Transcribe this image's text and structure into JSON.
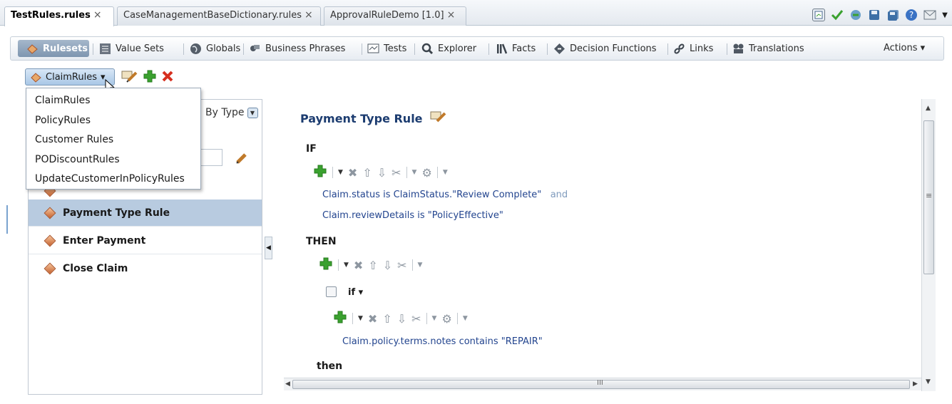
{
  "editor_tabs": [
    {
      "label": "TestRules.rules",
      "close": "×"
    },
    {
      "label": "CaseManagementBaseDictionary.rules",
      "close": "×"
    },
    {
      "label": "ApprovalRuleDemo [1.0]",
      "close": "×"
    }
  ],
  "nav": {
    "items": [
      {
        "label": "Rulesets",
        "icon": "rulesets-icon"
      },
      {
        "label": "Value Sets",
        "icon": "value-sets-icon"
      },
      {
        "label": "Globals",
        "icon": "globe-icon"
      },
      {
        "label": "Business Phrases",
        "icon": "business-phrases-icon"
      },
      {
        "label": "Tests",
        "icon": "tests-icon"
      },
      {
        "label": "Explorer",
        "icon": "search-icon"
      },
      {
        "label": "Facts",
        "icon": "facts-icon"
      },
      {
        "label": "Decision Functions",
        "icon": "decision-functions-icon"
      },
      {
        "label": "Links",
        "icon": "link-icon"
      },
      {
        "label": "Translations",
        "icon": "translations-icon"
      }
    ],
    "actions": "Actions ▾"
  },
  "ruleset_selector": {
    "value": "ClaimRules",
    "arrow": "▾"
  },
  "dropdown_options": [
    "ClaimRules",
    "PolicyRules",
    "Customer Rules",
    "PODiscountRules",
    "UpdateCustomerInPolicyRules"
  ],
  "left_panel": {
    "sort_label": "By Type",
    "rules": [
      "Payment Type Rule",
      "Enter Payment",
      "Close Claim"
    ]
  },
  "rule": {
    "title": "Payment Type Rule",
    "if_kw": "IF",
    "then_kw": "THEN",
    "conditions": [
      {
        "text": "Claim.status   is   ClaimStatus.\"Review Complete\"",
        "conj": "and"
      },
      {
        "text": "Claim.reviewDetails   is   \"PolicyEffective\"",
        "conj": ""
      }
    ],
    "nested_if": "if ▾",
    "nested_condition": "Claim.policy.terms.notes   contains   \"REPAIR\"",
    "nested_then": "then"
  },
  "scrollbar": {
    "h_center": "III",
    "v_center": "≡"
  },
  "colors": {
    "accent": "#1c3c70",
    "condition": "#23458f",
    "selected_row": "#b8cbe0",
    "add": "#3aa12f",
    "delete": "#d62f1f"
  }
}
